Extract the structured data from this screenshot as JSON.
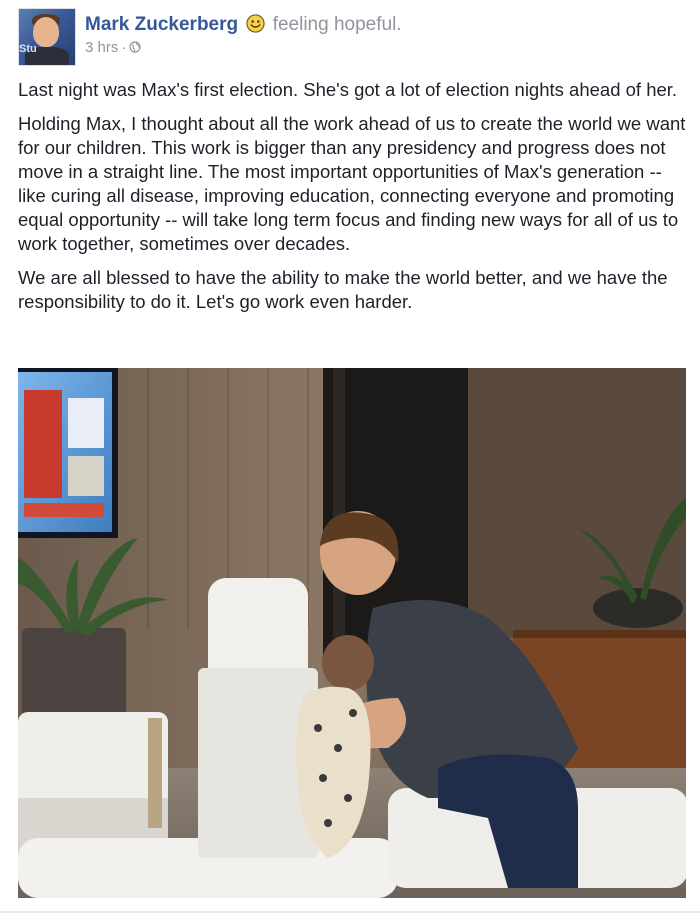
{
  "post": {
    "author": "Mark Zuckerberg",
    "feeling": "feeling hopeful.",
    "feeling_icon": "smiling-face-icon",
    "timestamp": "3 hrs",
    "separator": "·",
    "audience_icon": "globe-icon",
    "avatar_badge": "Stu",
    "paragraphs": [
      "Last night was Max's first election. She's got a lot of election nights ahead of her.",
      "Holding Max, I thought about all the work ahead of us to create the world we want for our children. This work is bigger than any presidency and progress does not move in a straight line. The most important opportunities of Max's generation -- like curing all disease, improving education, connecting everyone and promoting equal opportunity -- will take long term focus and finding new ways for all of us to work together, sometimes over decades.",
      "We are all blessed to have the ability to make the world better, and we have the responsibility to do it. Let's go work even harder."
    ]
  },
  "colors": {
    "link": "#365899",
    "secondary_text": "#90949c",
    "body_text": "#1d2129"
  }
}
